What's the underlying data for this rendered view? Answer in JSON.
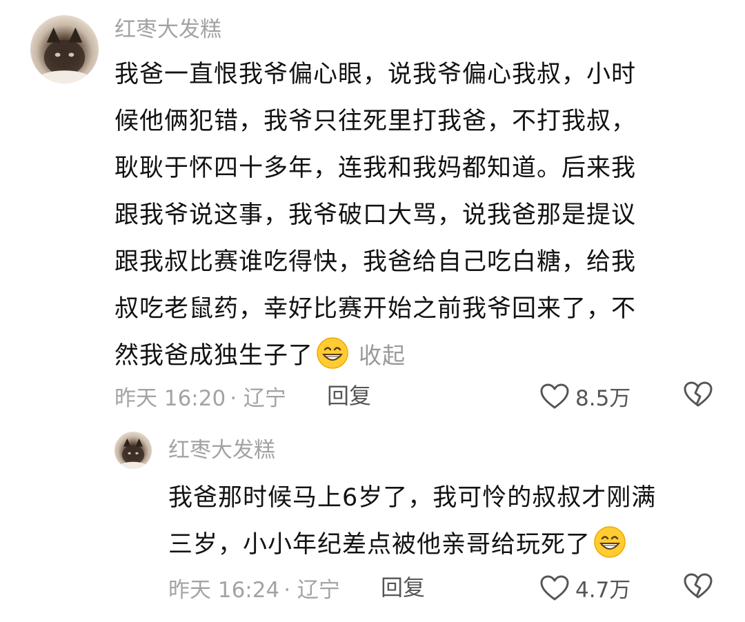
{
  "comments": [
    {
      "username": "红枣大发糕",
      "text_lines": [
        "我爸一直恨我爷偏心眼，说我爷偏心我叔，小时",
        "候他俩犯错，我爷只往死里打我爸，不打我叔，",
        "耿耿于怀四十多年，连我和我妈都知道。后来我",
        "跟我爷说这事，我爷破口大骂，说我爸那是提议",
        "跟我叔比赛谁吃得快，我爸给自己吃白糖，给我",
        "叔吃老鼠药，幸好比赛开始之前我爷回来了，不",
        "然我爸成独生子了"
      ],
      "emoji": "grinning-face-emoji",
      "collapse_label": "收起",
      "timestamp": "昨天 16:20",
      "location": "· 辽宁",
      "reply_label": "回复",
      "like_count": "8.5万"
    },
    {
      "username": "红枣大发糕",
      "text_lines": [
        "我爸那时候马上6岁了，我可怜的叔叔才刚满",
        "三岁，小小年纪差点被他亲哥给玩死了"
      ],
      "emoji": "grinning-face-emoji",
      "timestamp": "昨天 16:24",
      "location": "· 辽宁",
      "reply_label": "回复",
      "like_count": "4.7万"
    }
  ],
  "colors": {
    "username": "#a3a3a3",
    "text": "#121212",
    "meta": "#a3a3a3",
    "action": "#555555"
  }
}
